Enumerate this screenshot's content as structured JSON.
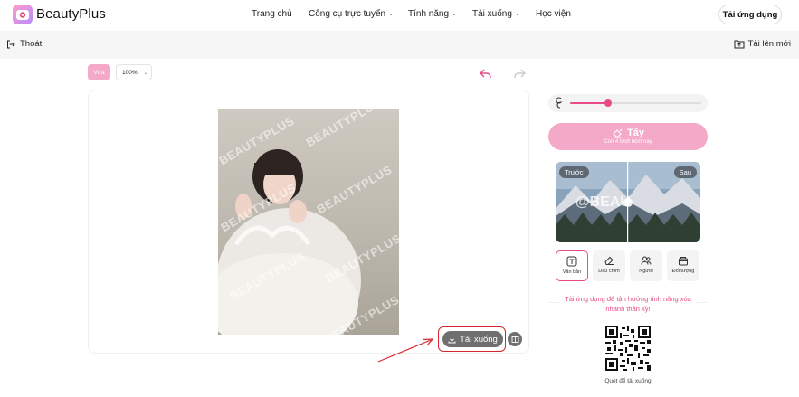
{
  "brand": {
    "name": "BeautyPlus"
  },
  "nav": {
    "items": [
      {
        "label": "Trang chủ",
        "dropdown": false
      },
      {
        "label": "Công cụ trực tuyến",
        "dropdown": true
      },
      {
        "label": "Tính năng",
        "dropdown": true
      },
      {
        "label": "Tải xuống",
        "dropdown": true
      },
      {
        "label": "Học viện",
        "dropdown": false
      }
    ],
    "get_app_label": "Tải ứng dụng"
  },
  "subbar": {
    "exit_label": "Thoát",
    "upload_new_label": "Tải lên mới"
  },
  "toolbar": {
    "fit_label": "Vừa",
    "zoom_value": "100%"
  },
  "canvas": {
    "watermark_text": "BEAUTYPLUS",
    "download_label": "Tải xuống"
  },
  "panel": {
    "erase_label": "Tẩy",
    "erase_remaining": "Còn 4 lượt hôm nay",
    "slider_value": 0.29,
    "before_label": "Trước",
    "after_label": "Sau",
    "preview_watermark": "@BEAU",
    "tools": [
      {
        "label": "Văn bản",
        "icon": "text-box-icon",
        "active": true
      },
      {
        "label": "Dấu chìm",
        "icon": "eraser-icon",
        "active": false
      },
      {
        "label": "Người",
        "icon": "people-icon",
        "active": false
      },
      {
        "label": "Đối tượng",
        "icon": "object-icon",
        "active": false
      }
    ],
    "promo_text": "Tải ứng dụng để tận hưởng tính năng xóa nhanh thần kỳ!",
    "qr_caption": "Quét để tải xuống"
  },
  "colors": {
    "accent": "#e94b88",
    "accent_light": "#f4a9c8",
    "highlight_red": "#d8262f"
  }
}
